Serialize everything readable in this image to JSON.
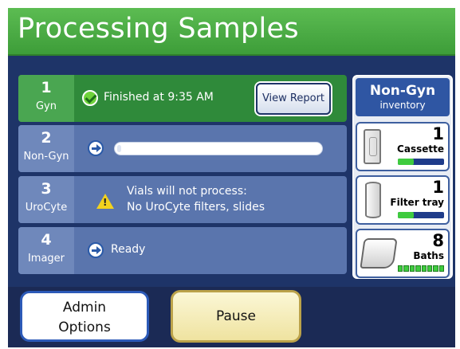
{
  "header": {
    "title": "Processing Samples"
  },
  "rows": [
    {
      "number": "1",
      "label": "Gyn",
      "status": "Finished at  9:35 AM",
      "button": "View Report"
    },
    {
      "number": "2",
      "label": "Non-Gyn",
      "progress": 0.02
    },
    {
      "number": "3",
      "label": "UroCyte",
      "message_line1": "Vials will not process:",
      "message_line2": "No UroCyte filters, slides"
    },
    {
      "number": "4",
      "label": "Imager",
      "status": "Ready"
    }
  ],
  "inventory": {
    "title": "Non-Gyn",
    "subtitle": "inventory",
    "items": [
      {
        "count": "1",
        "name": "Cassette",
        "level": 0.35
      },
      {
        "count": "1",
        "name": "Filter tray",
        "level": 0.35
      },
      {
        "count": "8",
        "name": "Baths",
        "level": 1.0
      }
    ]
  },
  "buttons": {
    "admin_line1": "Admin",
    "admin_line2": "Options",
    "pause": "Pause"
  },
  "colors": {
    "title_green": "#4aae47",
    "panel_blue": "#1e3468",
    "row_blue": "#5a75ad",
    "row_green": "#2f8a3a",
    "pause_yellow": "#efe3a0"
  }
}
